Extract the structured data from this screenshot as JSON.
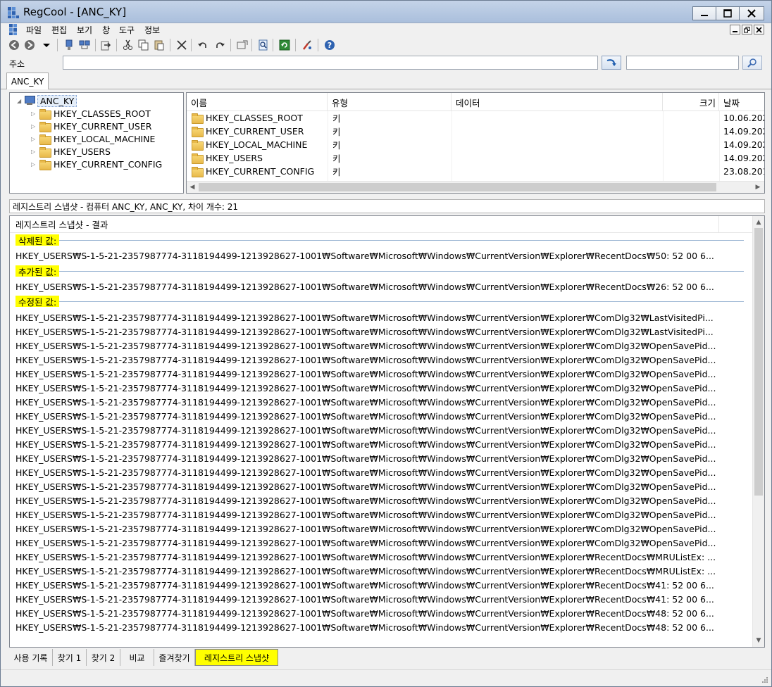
{
  "window": {
    "title": "RegCool - [ANC_KY]",
    "minimize": "—",
    "maximize": "☐",
    "close": "✕"
  },
  "menu": [
    "파일",
    "편집",
    "보기",
    "창",
    "도구",
    "정보"
  ],
  "address": {
    "label": "주소",
    "value": "",
    "search_value": ""
  },
  "doc_tab": "ANC_KY",
  "tree": {
    "root": "ANC_KY",
    "items": [
      "HKEY_CLASSES_ROOT",
      "HKEY_CURRENT_USER",
      "HKEY_LOCAL_MACHINE",
      "HKEY_USERS",
      "HKEY_CURRENT_CONFIG"
    ]
  },
  "list": {
    "columns": [
      "이름",
      "유형",
      "데이터",
      "크기",
      "날짜"
    ],
    "rows": [
      {
        "name": "HKEY_CLASSES_ROOT",
        "type": "키",
        "data": "",
        "size": "",
        "date": "10.06.2021"
      },
      {
        "name": "HKEY_CURRENT_USER",
        "type": "키",
        "data": "",
        "size": "",
        "date": "14.09.2021"
      },
      {
        "name": "HKEY_LOCAL_MACHINE",
        "type": "키",
        "data": "",
        "size": "",
        "date": "14.09.2021"
      },
      {
        "name": "HKEY_USERS",
        "type": "키",
        "data": "",
        "size": "",
        "date": "14.09.2021"
      },
      {
        "name": "HKEY_CURRENT_CONFIG",
        "type": "키",
        "data": "",
        "size": "",
        "date": "23.08.2017"
      }
    ]
  },
  "snapshot": {
    "header": "레지스트리 스냅샷 - 컴퓨터 ANC_KY, ANC_KY, 차이 개수: 21",
    "results_title": "레지스트리 스냅샷 - 결과",
    "deleted_label": "삭제된 값:",
    "deleted": [
      "HKEY_USERS₩S-1-5-21-2357987774-3118194499-1213928627-1001₩Software₩Microsoft₩Windows₩CurrentVersion₩Explorer₩RecentDocs₩50: 52 00 6..."
    ],
    "added_label": "추가된 값:",
    "added": [
      "HKEY_USERS₩S-1-5-21-2357987774-3118194499-1213928627-1001₩Software₩Microsoft₩Windows₩CurrentVersion₩Explorer₩RecentDocs₩26: 52 00 6..."
    ],
    "modified_label": "수정된 값:",
    "modified": [
      "HKEY_USERS₩S-1-5-21-2357987774-3118194499-1213928627-1001₩Software₩Microsoft₩Windows₩CurrentVersion₩Explorer₩ComDlg32₩LastVisitedPi...",
      "HKEY_USERS₩S-1-5-21-2357987774-3118194499-1213928627-1001₩Software₩Microsoft₩Windows₩CurrentVersion₩Explorer₩ComDlg32₩LastVisitedPi...",
      "HKEY_USERS₩S-1-5-21-2357987774-3118194499-1213928627-1001₩Software₩Microsoft₩Windows₩CurrentVersion₩Explorer₩ComDlg32₩OpenSavePid...",
      "HKEY_USERS₩S-1-5-21-2357987774-3118194499-1213928627-1001₩Software₩Microsoft₩Windows₩CurrentVersion₩Explorer₩ComDlg32₩OpenSavePid...",
      "HKEY_USERS₩S-1-5-21-2357987774-3118194499-1213928627-1001₩Software₩Microsoft₩Windows₩CurrentVersion₩Explorer₩ComDlg32₩OpenSavePid...",
      "HKEY_USERS₩S-1-5-21-2357987774-3118194499-1213928627-1001₩Software₩Microsoft₩Windows₩CurrentVersion₩Explorer₩ComDlg32₩OpenSavePid...",
      "HKEY_USERS₩S-1-5-21-2357987774-3118194499-1213928627-1001₩Software₩Microsoft₩Windows₩CurrentVersion₩Explorer₩ComDlg32₩OpenSavePid...",
      "HKEY_USERS₩S-1-5-21-2357987774-3118194499-1213928627-1001₩Software₩Microsoft₩Windows₩CurrentVersion₩Explorer₩ComDlg32₩OpenSavePid...",
      "HKEY_USERS₩S-1-5-21-2357987774-3118194499-1213928627-1001₩Software₩Microsoft₩Windows₩CurrentVersion₩Explorer₩ComDlg32₩OpenSavePid...",
      "HKEY_USERS₩S-1-5-21-2357987774-3118194499-1213928627-1001₩Software₩Microsoft₩Windows₩CurrentVersion₩Explorer₩ComDlg32₩OpenSavePid...",
      "HKEY_USERS₩S-1-5-21-2357987774-3118194499-1213928627-1001₩Software₩Microsoft₩Windows₩CurrentVersion₩Explorer₩ComDlg32₩OpenSavePid...",
      "HKEY_USERS₩S-1-5-21-2357987774-3118194499-1213928627-1001₩Software₩Microsoft₩Windows₩CurrentVersion₩Explorer₩ComDlg32₩OpenSavePid...",
      "HKEY_USERS₩S-1-5-21-2357987774-3118194499-1213928627-1001₩Software₩Microsoft₩Windows₩CurrentVersion₩Explorer₩ComDlg32₩OpenSavePid...",
      "HKEY_USERS₩S-1-5-21-2357987774-3118194499-1213928627-1001₩Software₩Microsoft₩Windows₩CurrentVersion₩Explorer₩ComDlg32₩OpenSavePid...",
      "HKEY_USERS₩S-1-5-21-2357987774-3118194499-1213928627-1001₩Software₩Microsoft₩Windows₩CurrentVersion₩Explorer₩ComDlg32₩OpenSavePid...",
      "HKEY_USERS₩S-1-5-21-2357987774-3118194499-1213928627-1001₩Software₩Microsoft₩Windows₩CurrentVersion₩Explorer₩ComDlg32₩OpenSavePid...",
      "HKEY_USERS₩S-1-5-21-2357987774-3118194499-1213928627-1001₩Software₩Microsoft₩Windows₩CurrentVersion₩Explorer₩ComDlg32₩OpenSavePid...",
      "HKEY_USERS₩S-1-5-21-2357987774-3118194499-1213928627-1001₩Software₩Microsoft₩Windows₩CurrentVersion₩Explorer₩RecentDocs₩MRUListEx: ...",
      "HKEY_USERS₩S-1-5-21-2357987774-3118194499-1213928627-1001₩Software₩Microsoft₩Windows₩CurrentVersion₩Explorer₩RecentDocs₩MRUListEx: ...",
      "HKEY_USERS₩S-1-5-21-2357987774-3118194499-1213928627-1001₩Software₩Microsoft₩Windows₩CurrentVersion₩Explorer₩RecentDocs₩41: 52 00 6...",
      "HKEY_USERS₩S-1-5-21-2357987774-3118194499-1213928627-1001₩Software₩Microsoft₩Windows₩CurrentVersion₩Explorer₩RecentDocs₩41: 52 00 6...",
      "HKEY_USERS₩S-1-5-21-2357987774-3118194499-1213928627-1001₩Software₩Microsoft₩Windows₩CurrentVersion₩Explorer₩RecentDocs₩48: 52 00 6...",
      "HKEY_USERS₩S-1-5-21-2357987774-3118194499-1213928627-1001₩Software₩Microsoft₩Windows₩CurrentVersion₩Explorer₩RecentDocs₩48: 52 00 6..."
    ]
  },
  "bottom_tabs": [
    "사용 기록",
    "찾기 1",
    "찾기 2",
    "비교",
    "즐겨찾기",
    "레지스트리 스냅샷"
  ],
  "colors": {
    "highlight": "#ffff00",
    "titlebar": "#b6c8e0"
  }
}
